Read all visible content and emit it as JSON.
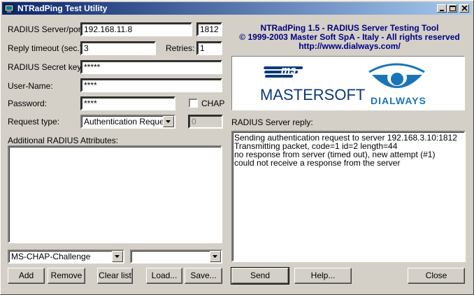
{
  "window": {
    "title": "NTRadPing Test Utility"
  },
  "form": {
    "server_label": "RADIUS Server/port:",
    "server_value": "192.168.11.8",
    "port_value": "1812",
    "timeout_label": "Reply timeout (sec.):",
    "timeout_value": "3",
    "retries_label": "Retries:",
    "retries_value": "1",
    "secret_label": "RADIUS Secret key:",
    "secret_value": "*****",
    "username_label": "User-Name:",
    "username_value": "****",
    "password_label": "Password:",
    "password_value": "****",
    "chap_label": "CHAP",
    "request_type_label": "Request type:",
    "request_type_value": "Authentication Request",
    "request_count_value": "0",
    "attributes_label": "Additional RADIUS Attributes:",
    "attribute_select_value": "MS-CHAP-Challenge",
    "attribute_value_select": ""
  },
  "header": {
    "line1": "NTRadPing 1.5 - RADIUS Server Testing Tool",
    "line2": "© 1999-2003 Master Soft SpA - Italy - All rights reserved",
    "line3": "http://www.dialways.com/"
  },
  "logos": {
    "ms_text": "ms",
    "mastersoft_text": "MASTERSOFT",
    "dialways_text": "DIALWAYS",
    "mastersoft_color": "#0b3a78",
    "dialways_color": "#1a74b9"
  },
  "reply": {
    "label": "RADIUS Server reply:",
    "lines": [
      "Sending authentication request to server 192.168.3.10:1812",
      "Transmitting packet, code=1 id=2 length=44",
      "no response from server (timed out), new attempt (#1)",
      "could not receive a response from the server"
    ]
  },
  "buttons": {
    "add": "Add",
    "remove": "Remove",
    "clear": "Clear list",
    "load": "Load...",
    "save": "Save...",
    "send": "Send",
    "help": "Help...",
    "close": "Close"
  }
}
